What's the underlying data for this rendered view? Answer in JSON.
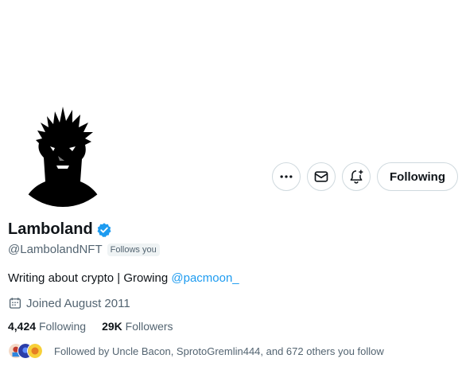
{
  "profile": {
    "display_name": "Lamboland",
    "handle": "@LambolandNFT",
    "follows_you": "Follows you",
    "bio_text": "Writing about crypto | Growing ",
    "bio_mention": "@pacmoon_",
    "joined": "Joined August 2011",
    "following_count": "4,424",
    "following_label": "Following",
    "followers_count": "29K",
    "followers_label": "Followers",
    "followed_by": "Followed by Uncle Bacon, SprotoGremlin444, and 672 others you follow"
  },
  "actions": {
    "follow_state_label": "Following"
  },
  "icons": {
    "more": "more-horizontal-icon",
    "message": "envelope-icon",
    "notifications": "bell-plus-icon",
    "verified": "verified-badge-icon",
    "calendar": "calendar-icon"
  },
  "colors": {
    "accent": "#1d9bf0",
    "text_primary": "#0f1419",
    "text_secondary": "#536471",
    "border": "#cfd9de"
  }
}
